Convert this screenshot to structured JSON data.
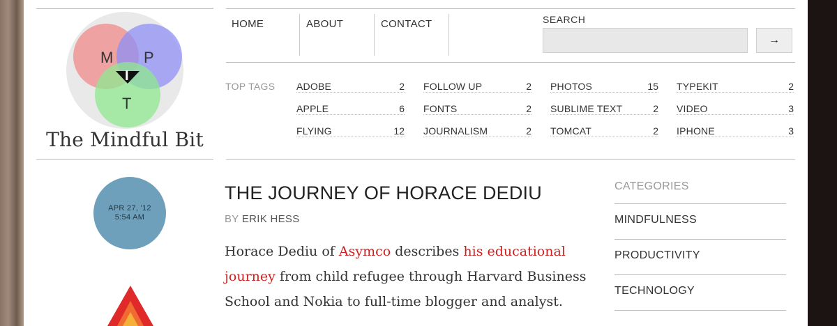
{
  "site": {
    "title": "The Mindful Bit",
    "logo_letters": {
      "m": "M",
      "i": "I",
      "p": "P",
      "t": "T"
    }
  },
  "nav": {
    "items": [
      {
        "label": "HOME"
      },
      {
        "label": "ABOUT"
      },
      {
        "label": "CONTACT"
      }
    ]
  },
  "search": {
    "label": "SEARCH",
    "value": "",
    "button_glyph": "→"
  },
  "tags": {
    "label": "TOP TAGS",
    "items": [
      {
        "name": "ADOBE",
        "count": "2"
      },
      {
        "name": "APPLE",
        "count": "6"
      },
      {
        "name": "FLYING",
        "count": "12"
      },
      {
        "name": "FOLLOW UP",
        "count": "2"
      },
      {
        "name": "FONTS",
        "count": "2"
      },
      {
        "name": "JOURNALISM",
        "count": "2"
      },
      {
        "name": "PHOTOS",
        "count": "15"
      },
      {
        "name": "SUBLIME TEXT",
        "count": "2"
      },
      {
        "name": "TOMCAT",
        "count": "2"
      },
      {
        "name": "TYPEKIT",
        "count": "2"
      },
      {
        "name": "VIDEO",
        "count": "3"
      },
      {
        "name": "IPHONE",
        "count": "3"
      }
    ]
  },
  "post": {
    "date": "APR 27, '12",
    "time": "5:54 AM",
    "title": "THE JOURNEY OF HORACE DEDIU",
    "by_label": "BY",
    "author": "ERIK HESS",
    "body": {
      "t1": "Horace Dediu of ",
      "link1": "Asymco",
      "t2": " describes ",
      "link2": "his educational journey",
      "t3": " from child refugee through Harvard Business School and Nokia to full-time blogger and analyst."
    }
  },
  "categories": {
    "heading": "CATEGORIES",
    "items": [
      {
        "label": "MINDFULNESS"
      },
      {
        "label": "PRODUCTIVITY"
      },
      {
        "label": "TECHNOLOGY"
      }
    ]
  },
  "colors": {
    "link": "#cc1f1f",
    "date_circle": "#6fa0bb",
    "venn_red": "#ef8a8a",
    "venn_blue": "#8f8ff5",
    "venn_green": "#8fe88f"
  }
}
